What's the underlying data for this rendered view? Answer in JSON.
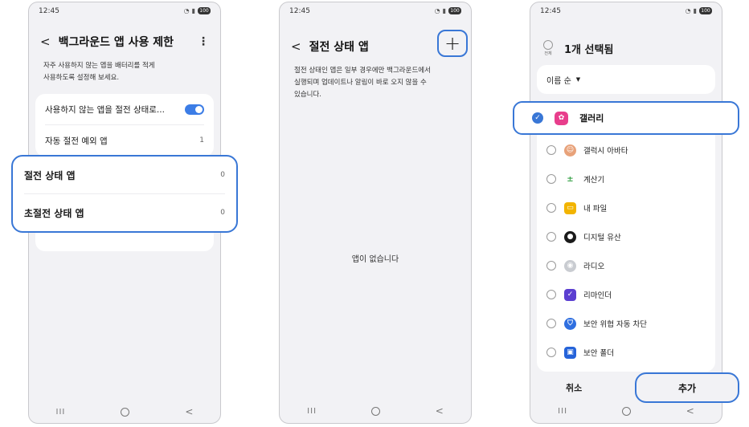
{
  "status": {
    "time": "12:45",
    "battery": "100"
  },
  "nav": {
    "recent": "III",
    "back": "<"
  },
  "screen1": {
    "title": "백그라운드 앱 사용 제한",
    "more": "⋮",
    "back": "<",
    "description": "자주 사용하지 않는 앱을 배터리를 적게\n사용하도록 설정해 보세요.",
    "toggle_row": {
      "label": "사용하지 않는 앱을 절전 상태로...",
      "enabled": true
    },
    "exceptions_row": {
      "label": "자동 절전 예외 앱",
      "value": "1"
    },
    "sleeping_row": {
      "label": "절전 상태 앱",
      "value": "0"
    },
    "deep_sleeping_row": {
      "label": "초절전 상태 앱",
      "value": "0"
    }
  },
  "screen2": {
    "title": "절전 상태 앱",
    "back": "<",
    "add": "+",
    "description": "절전 상태인 앱은 일부 경우에만 백그라운드에서\n실행되며 업데이트나 알림이 바로 오지 않을 수\n있습니다.",
    "empty": "앱이 없습니다"
  },
  "screen3": {
    "all_label": "전체",
    "selected_title": "1개 선택됨",
    "sort_label": "이름 순",
    "sort_caret": "▼",
    "selected_app": {
      "name": "갤러리",
      "check": "✓"
    },
    "apps": [
      {
        "name": "갤럭시 아바타",
        "icon": "avatar-icon",
        "color": "#e8a27a"
      },
      {
        "name": "계산기",
        "icon": "calculator-icon",
        "color": "#3aa34a"
      },
      {
        "name": "내 파일",
        "icon": "folder-icon",
        "color": "#f2b400"
      },
      {
        "name": "디지털 유산",
        "icon": "digital-legacy-icon",
        "color": "#1a1a1a"
      },
      {
        "name": "라디오",
        "icon": "radio-icon",
        "color": "#c9ccd1"
      },
      {
        "name": "리마인더",
        "icon": "reminder-icon",
        "color": "#5b3fd1"
      },
      {
        "name": "보안 위협 자동 차단",
        "icon": "shield-icon",
        "color": "#2f6fe0"
      },
      {
        "name": "보안 폴더",
        "icon": "secure-folder-icon",
        "color": "#2563d9"
      }
    ],
    "cancel": "취소",
    "add": "추가"
  },
  "colors": {
    "accent": "#3977d6",
    "background": "#f2f2f5",
    "gallery_icon": "#e83e8c"
  }
}
